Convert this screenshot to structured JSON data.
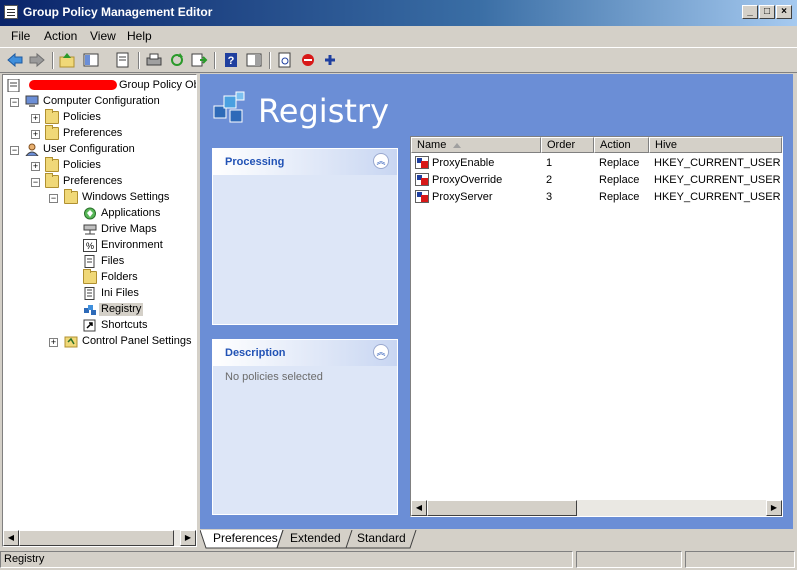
{
  "window": {
    "title": "Group Policy Management Editor",
    "controls": {
      "minimize": "_",
      "maximize": "□",
      "close": "×"
    }
  },
  "menu": [
    "File",
    "Action",
    "View",
    "Help"
  ],
  "toolbar": [
    "back-icon",
    "forward-icon",
    "up-folder-icon",
    "show-hide-tree-icon",
    "properties-icon",
    "print-icon",
    "refresh-icon",
    "export-list-icon",
    "help-icon",
    "show-action-pane-icon",
    "new-item-icon",
    "stop-icon",
    "add-icon"
  ],
  "tree": {
    "root": "Group Policy Ob",
    "computer_config": "Computer Configuration",
    "cc_policies": "Policies",
    "cc_preferences": "Preferences",
    "user_config": "User Configuration",
    "uc_policies": "Policies",
    "uc_preferences": "Preferences",
    "windows_settings": "Windows Settings",
    "applications": "Applications",
    "drive_maps": "Drive Maps",
    "environment": "Environment",
    "files": "Files",
    "folders": "Folders",
    "ini_files": "Ini Files",
    "registry": "Registry",
    "shortcuts": "Shortcuts",
    "control_panel": "Control Panel Settings"
  },
  "header": {
    "title": "Registry"
  },
  "panels": {
    "processing": {
      "title": "Processing",
      "body": ""
    },
    "description": {
      "title": "Description",
      "body": "No policies selected"
    }
  },
  "list": {
    "columns": [
      "Name",
      "Order",
      "Action",
      "Hive"
    ],
    "rows": [
      {
        "name": "ProxyEnable",
        "order": "1",
        "action": "Replace",
        "hive": "HKEY_CURRENT_USER"
      },
      {
        "name": "ProxyOverride",
        "order": "2",
        "action": "Replace",
        "hive": "HKEY_CURRENT_USER"
      },
      {
        "name": "ProxyServer",
        "order": "3",
        "action": "Replace",
        "hive": "HKEY_CURRENT_USER"
      }
    ]
  },
  "tabs": [
    "Preferences",
    "Extended",
    "Standard"
  ],
  "status": {
    "text": "Registry"
  },
  "colors": {
    "content_bg": "#6b8ed6",
    "panel_title": "#2152b5",
    "redaction": "#ff0000"
  }
}
